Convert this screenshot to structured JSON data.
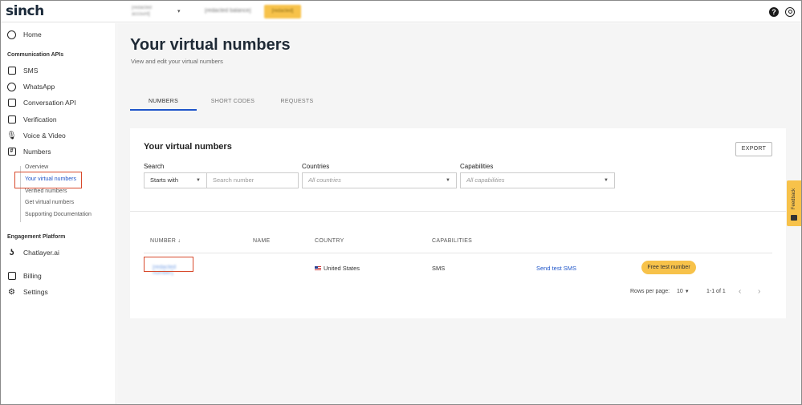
{
  "header": {
    "logo": "sinch",
    "account": "[redacted account]",
    "balance": "[redacted balance]",
    "upgrade_label": "[redacted]",
    "help_glyph": "?"
  },
  "sidebar": {
    "home": "Home",
    "section_communication": "Communication APIs",
    "items": [
      "SMS",
      "WhatsApp",
      "Conversation API",
      "Verification",
      "Voice & Video",
      "Numbers"
    ],
    "numbers_sub": [
      "Overview",
      "Your virtual numbers",
      "Verified numbers",
      "Get virtual numbers",
      "Supporting Documentation"
    ],
    "section_engagement": "Engagement Platform",
    "chatlayer": "Chatlayer.ai",
    "billing": "Billing",
    "settings": "Settings"
  },
  "page": {
    "title": "Your virtual numbers",
    "subtitle": "View and edit your virtual numbers"
  },
  "tabs": [
    "NUMBERS",
    "SHORT CODES",
    "REQUESTS"
  ],
  "card": {
    "title": "Your virtual numbers",
    "export_label": "EXPORT",
    "search_label": "Search",
    "search_mode": "Starts with",
    "search_placeholder": "Search number",
    "countries_label": "Countries",
    "countries_placeholder": "All countries",
    "capabilities_label": "Capabilities",
    "capabilities_placeholder": "All capabilities"
  },
  "table": {
    "headers": [
      "NUMBER ↓",
      "NAME",
      "COUNTRY",
      "CAPABILITIES"
    ],
    "rows": [
      {
        "number": "[redacted number]",
        "name": "",
        "country": "United States",
        "capabilities": "SMS",
        "action": "Send test SMS",
        "badge": "Free test number"
      }
    ]
  },
  "pagination": {
    "rows_label": "Rows per page:",
    "rows_value": "10",
    "range": "1-1 of 1"
  },
  "feedback": {
    "label": "Feedback"
  },
  "colors": {
    "accent": "#1f55c9",
    "highlight": "#d84a2c",
    "badge": "#f7c24a"
  }
}
